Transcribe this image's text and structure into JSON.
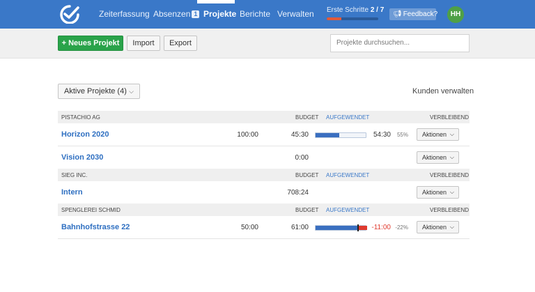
{
  "nav": {
    "items": [
      {
        "label": "Zeiterfassung"
      },
      {
        "label": "Absenzen",
        "badge": "1"
      },
      {
        "label": "Projekte"
      },
      {
        "label": "Berichte"
      },
      {
        "label": "Verwalten"
      }
    ],
    "onboarding": {
      "label": "Erste Schritte",
      "progress_text": "2 / 7",
      "progress_fraction": 0.2857
    },
    "feedback_label": "Feedback?",
    "avatar_initials": "HH"
  },
  "toolbar": {
    "new_project_label": "Neues Projekt",
    "import_label": "Import",
    "export_label": "Export",
    "search_placeholder": "Projekte durchsuchen..."
  },
  "filter": {
    "label": "Aktive Projekte (4)",
    "manage_clients_label": "Kunden verwalten"
  },
  "columns": {
    "budget": "BUDGET",
    "spent": "AUFGEWENDET",
    "remaining": "VERBLEIBEND"
  },
  "groups": [
    {
      "client": "PISTACHIO AG",
      "projects": [
        {
          "name": "Horizon 2020",
          "budget": "100:00",
          "spent": "45:30",
          "remaining": "54:30",
          "pct": "55%",
          "used_fraction": 0.455,
          "actions": "Aktionen"
        },
        {
          "name": "Vision 2030",
          "budget": "",
          "spent": "0:00",
          "remaining": "",
          "pct": "",
          "actions": "Aktionen"
        }
      ]
    },
    {
      "client": "SIEG INC.",
      "projects": [
        {
          "name": "Intern",
          "budget": "",
          "spent": "708:24",
          "remaining": "",
          "pct": "",
          "actions": "Aktionen"
        }
      ]
    },
    {
      "client": "SPENGLEREI SCHMID",
      "projects": [
        {
          "name": "Bahnhofstrasse 22",
          "budget": "50:00",
          "spent": "61:00",
          "remaining": "-11:00",
          "pct": "-22%",
          "used_fraction": 1.22,
          "actions": "Aktionen"
        }
      ]
    }
  ],
  "colors": {
    "nav": "#3a78c8",
    "primary": "#2aa34a",
    "link": "#2e6fc1",
    "bar": "#3a6fc0",
    "over": "#e03a2e"
  }
}
